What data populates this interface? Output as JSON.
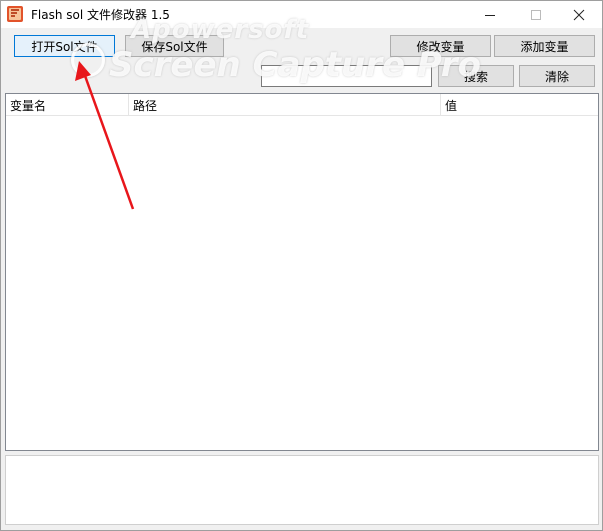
{
  "window": {
    "title": "Flash sol 文件修改器 1.5"
  },
  "toolbar": {
    "open_label": "打开Sol文件",
    "save_label": "保存Sol文件",
    "modify_label": "修改变量",
    "add_label": "添加变量",
    "search_label": "搜索",
    "clear_label": "清除"
  },
  "search": {
    "value": "",
    "placeholder": ""
  },
  "list": {
    "columns": [
      "变量名",
      "路径",
      "值"
    ],
    "rows": []
  },
  "watermark": {
    "line1": "Apowersoft",
    "line2": "Screen Capture Pro"
  },
  "colors": {
    "accent": "#0078d7",
    "arrow": "#e8161b",
    "icon": "#e2532a"
  },
  "icons": {
    "app": "flash-sol-app-icon",
    "minimize": "minimize-icon",
    "maximize": "maximize-icon",
    "close": "close-icon"
  }
}
